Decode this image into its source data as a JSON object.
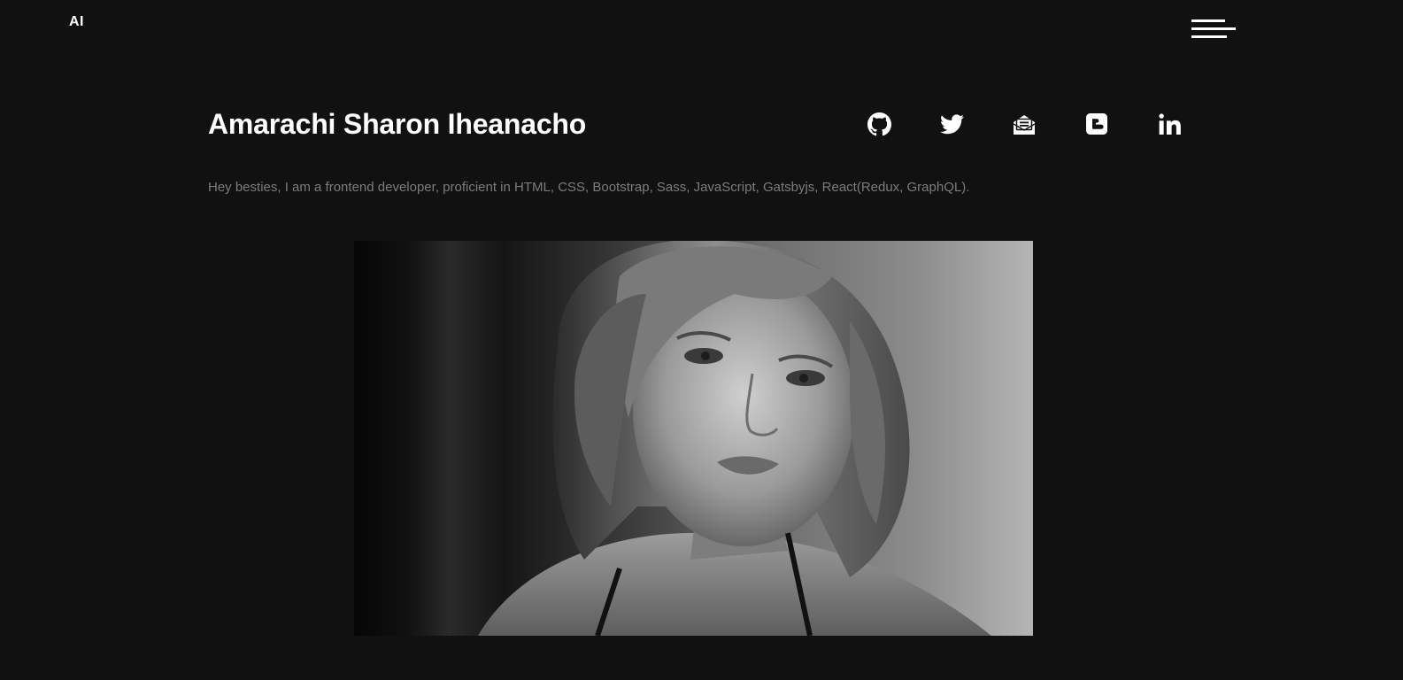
{
  "header": {
    "logo": "AI",
    "menu_icon": "hamburger-menu-icon"
  },
  "hero": {
    "name": "Amarachi Sharon Iheanacho",
    "bio": "Hey besties, I am a frontend developer, proficient in HTML, CSS, Bootstrap, Sass, JavaScript, Gatsbyjs, React(Redux, GraphQL)."
  },
  "socials": [
    {
      "icon": "github-icon"
    },
    {
      "icon": "twitter-icon"
    },
    {
      "icon": "email-icon"
    },
    {
      "icon": "blogger-icon"
    },
    {
      "icon": "linkedin-icon"
    }
  ],
  "colors": {
    "background": "#111111",
    "text": "#ffffff",
    "muted": "#7c7c7c"
  }
}
